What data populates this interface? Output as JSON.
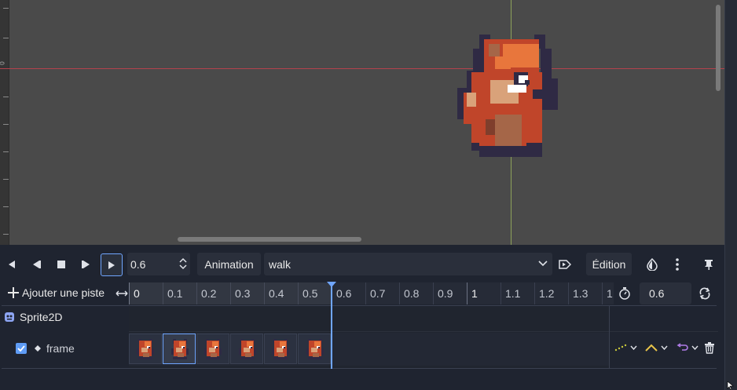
{
  "viewport": {
    "ruler_label": "0"
  },
  "toolbar": {
    "time_value": "0.6",
    "animation_button": "Animation",
    "animation_selected": "walk",
    "edit_button": "Édition"
  },
  "timeline": {
    "add_track_label": "Ajouter une piste",
    "ruler_ticks": [
      "0",
      "0.1",
      "0.2",
      "0.3",
      "0.4",
      "0.5",
      "0.6",
      "0.7",
      "0.8",
      "0.9",
      "1",
      "1.1",
      "1.2",
      "1.3",
      "1"
    ],
    "length_value": "0.6",
    "node_name": "Sprite2D",
    "track_name": "frame",
    "track_enabled": true,
    "keyframe_count": 6,
    "selected_keyframe": 1
  },
  "colors": {
    "accent": "#70a6ff",
    "x_axis": "#b5424d",
    "y_axis": "#8ea25a",
    "update_mode": "#c9c83a",
    "interp_mode": "#e9c54a",
    "loop_mode": "#b07ce8"
  }
}
